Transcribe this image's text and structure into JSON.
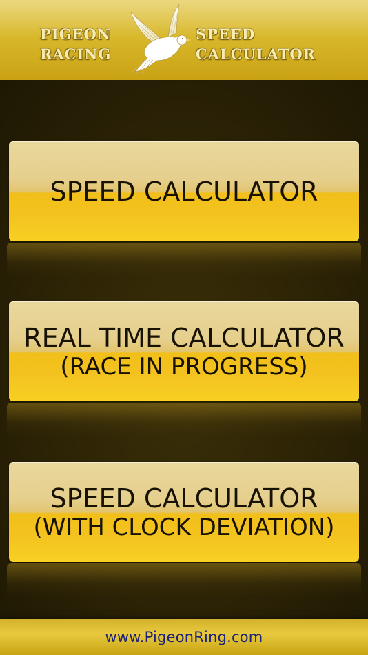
{
  "header": {
    "logo_left_line1": "PIGEON",
    "logo_left_line2": "RACING",
    "logo_right_line1": "SPEED",
    "logo_right_line2": "CALCULATOR",
    "logo_icon": "dove-icon"
  },
  "menu": {
    "buttons": [
      {
        "title": "SPEED CALCULATOR",
        "subtitle": ""
      },
      {
        "title": "REAL TIME CALCULATOR",
        "subtitle": "(RACE IN PROGRESS)"
      },
      {
        "title": "SPEED CALCULATOR",
        "subtitle": "(WITH CLOCK DEVIATION)"
      }
    ]
  },
  "footer": {
    "link_text": "www.PigeonRing.com"
  },
  "colors": {
    "button_gold": "#f4c320",
    "button_top": "#e9d79c",
    "background": "#2c2306",
    "footer_link": "#1c2276"
  }
}
